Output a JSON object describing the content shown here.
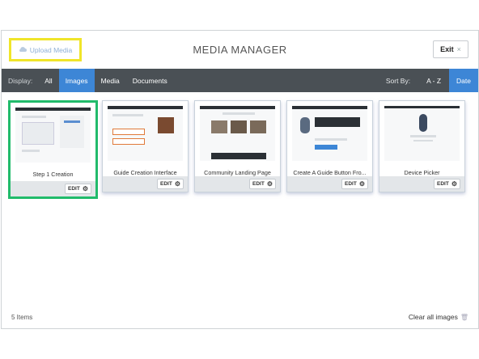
{
  "header": {
    "upload_label": "Upload Media",
    "title": "MEDIA MANAGER",
    "exit_label": "Exit",
    "exit_glyph": "×"
  },
  "toolbar": {
    "display_label": "Display:",
    "filters": [
      "All",
      "Images",
      "Media",
      "Documents"
    ],
    "active_filter": "Images",
    "sort_label": "Sort By:",
    "sort_options": [
      "A - Z",
      "Date"
    ],
    "active_sort": "Date"
  },
  "media_items": [
    {
      "name": "Step 1 Creation",
      "edit_label": "EDIT",
      "selected": true
    },
    {
      "name": "Guide Creation Interface",
      "edit_label": "EDIT",
      "selected": false
    },
    {
      "name": "Community Landing Page",
      "edit_label": "EDIT",
      "selected": false
    },
    {
      "name": "Create A Guide Button Fro...",
      "edit_label": "EDIT",
      "selected": false
    },
    {
      "name": "Device Picker",
      "edit_label": "EDIT",
      "selected": false
    }
  ],
  "status": {
    "item_count": "5 Items",
    "clear_label": "Clear all images"
  },
  "colors": {
    "accent": "#3d86d6",
    "selected_border": "#21bb6b",
    "upload_highlight": "#f0e52a",
    "toolbar_bg": "#4a5055"
  },
  "icons": {
    "upload": "cloud-upload-icon",
    "exit": "close-icon",
    "edit": "gear-icon",
    "clear": "trash-icon"
  }
}
